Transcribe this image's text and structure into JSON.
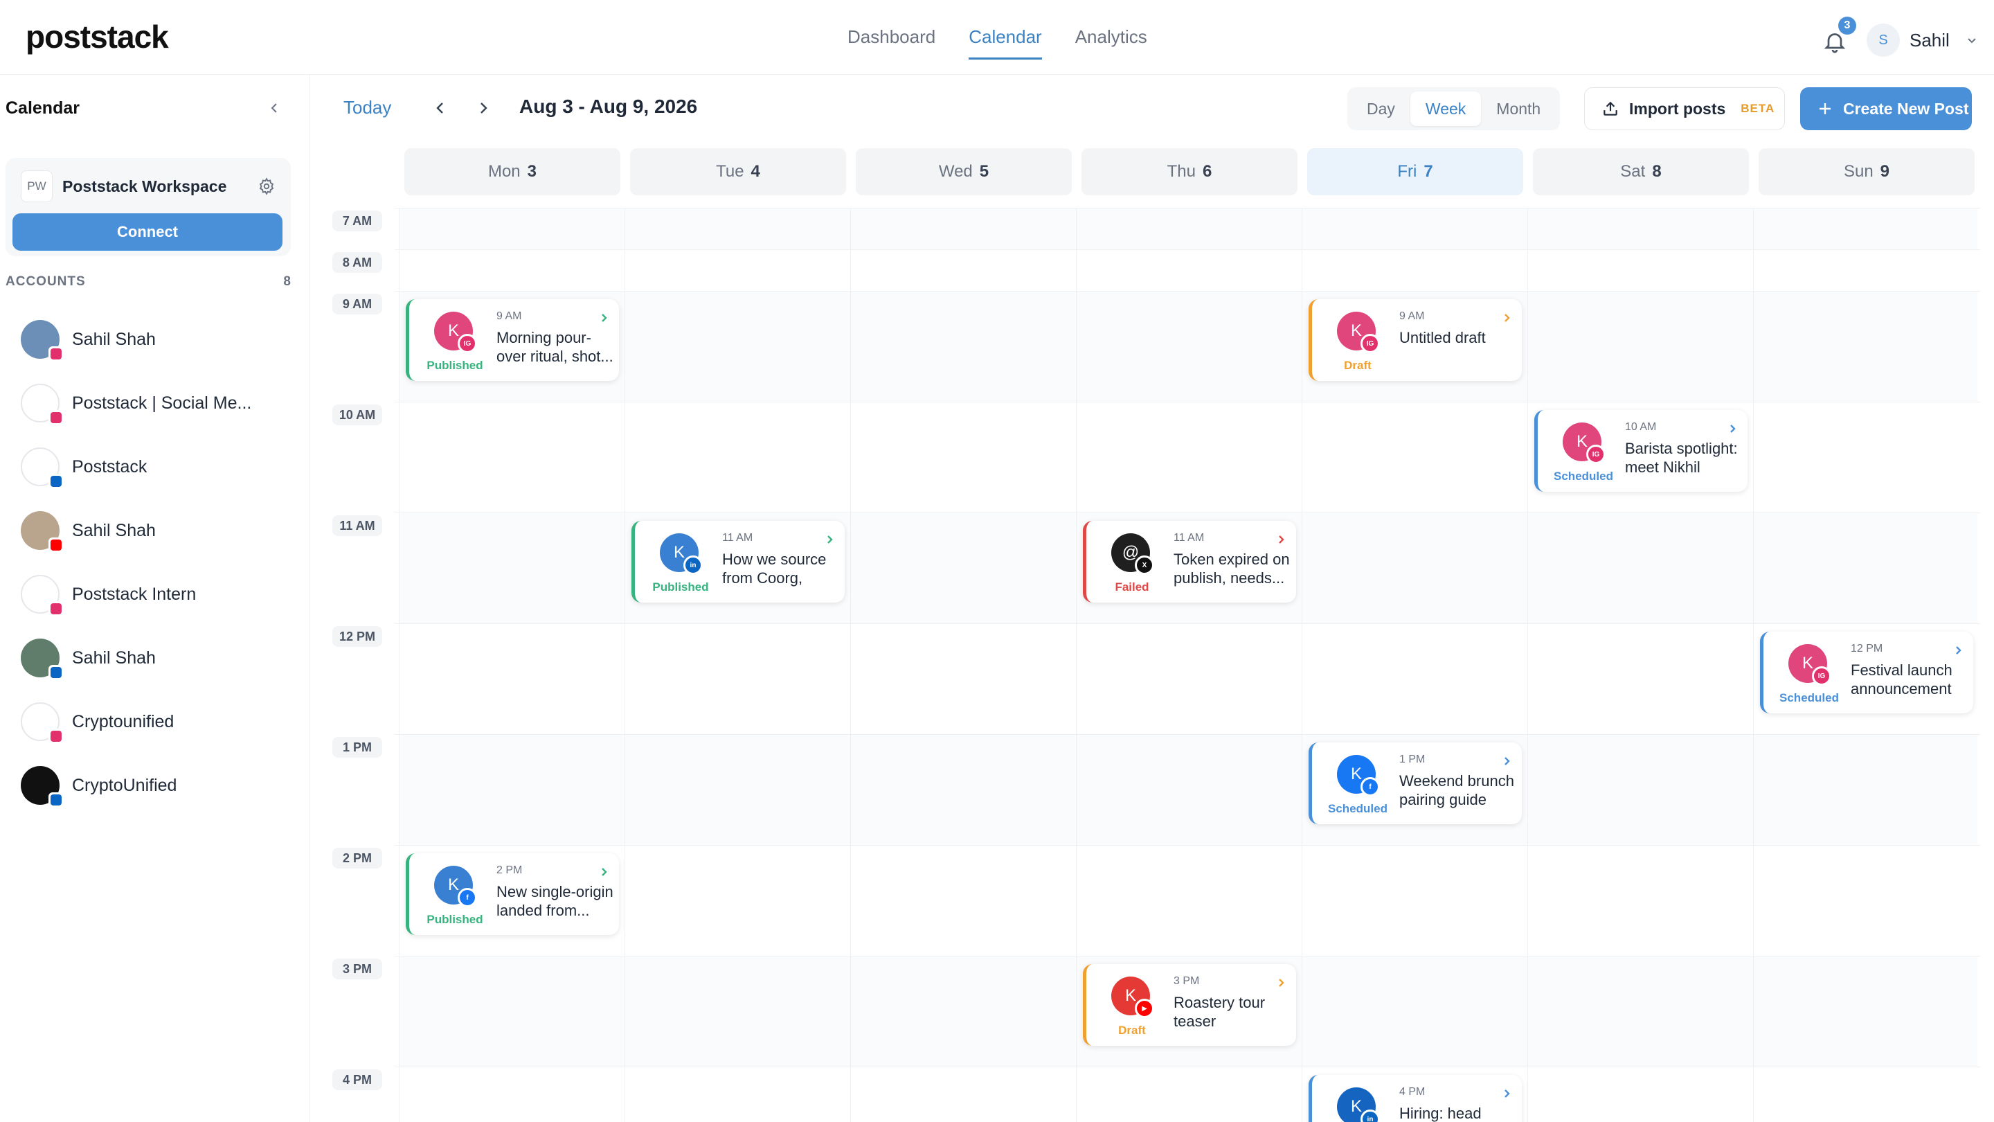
{
  "brand": {
    "logo": "poststack"
  },
  "nav": {
    "items": [
      {
        "label": "Dashboard"
      },
      {
        "label": "Calendar",
        "active": true
      },
      {
        "label": "Analytics"
      }
    ]
  },
  "notifications": {
    "count": "3"
  },
  "user": {
    "initial": "S",
    "name": "Sahil"
  },
  "sidebar": {
    "title": "Calendar",
    "workspace": {
      "initials": "PW",
      "name": "Poststack Workspace",
      "connect_label": "Connect"
    },
    "accounts_label": "ACCOUNTS",
    "accounts_count": "8",
    "accounts": [
      {
        "name": "Sahil Shah",
        "network": "instagram"
      },
      {
        "name": "Poststack | Social Me...",
        "network": "instagram"
      },
      {
        "name": "Poststack",
        "network": "linkedin"
      },
      {
        "name": "Sahil Shah",
        "network": "youtube"
      },
      {
        "name": "Poststack Intern",
        "network": "instagram"
      },
      {
        "name": "Sahil Shah",
        "network": "linkedin"
      },
      {
        "name": "Cryptounified",
        "network": "instagram"
      },
      {
        "name": "CryptoUnified",
        "network": "linkedin"
      }
    ]
  },
  "toolbar": {
    "today_label": "Today",
    "range_label": "Aug 3 - Aug 9, 2026",
    "views": [
      {
        "label": "Day"
      },
      {
        "label": "Week",
        "active": true
      },
      {
        "label": "Month"
      }
    ],
    "import_label": "Import posts",
    "beta_label": "BETA",
    "create_label": "Create New Post"
  },
  "calendar": {
    "days": [
      {
        "name": "Mon",
        "num": "3"
      },
      {
        "name": "Tue",
        "num": "4"
      },
      {
        "name": "Wed",
        "num": "5"
      },
      {
        "name": "Thu",
        "num": "6"
      },
      {
        "name": "Fri",
        "num": "7",
        "today": true
      },
      {
        "name": "Sat",
        "num": "8"
      },
      {
        "name": "Sun",
        "num": "9"
      }
    ],
    "hours": [
      "7 AM",
      "8 AM",
      "9 AM",
      "10 AM",
      "11 AM",
      "12 PM",
      "1 PM",
      "2 PM",
      "3 PM",
      "4 PM"
    ],
    "posts": [
      {
        "day": 0,
        "hour": 2,
        "time": "9 AM",
        "title": "Morning pour-over ritual, shot...",
        "status": "Published",
        "avatar": "K",
        "network": "instagram",
        "avatar_color": "#e0457b"
      },
      {
        "day": 4,
        "hour": 2,
        "time": "9 AM",
        "title": "Untitled draft",
        "status": "Draft",
        "avatar": "K",
        "network": "instagram",
        "avatar_color": "#e0457b"
      },
      {
        "day": 5,
        "hour": 3,
        "time": "10 AM",
        "title": "Barista spotlight: meet Nikhil",
        "status": "Scheduled",
        "avatar": "K",
        "network": "instagram",
        "avatar_color": "#e0457b"
      },
      {
        "day": 1,
        "hour": 4,
        "time": "11 AM",
        "title": "How we source from Coorg, and...",
        "status": "Published",
        "avatar": "K",
        "network": "linkedin",
        "avatar_color": "#3a80d2"
      },
      {
        "day": 3,
        "hour": 4,
        "time": "11 AM",
        "title": "Token expired on publish, needs...",
        "status": "Failed",
        "avatar": "@",
        "network": "x",
        "avatar_color": "#1f1f1f"
      },
      {
        "day": 6,
        "hour": 5,
        "time": "12 PM",
        "title": "Festival launch announcement",
        "status": "Scheduled",
        "avatar": "K",
        "network": "instagram",
        "avatar_color": "#e0457b"
      },
      {
        "day": 4,
        "hour": 6,
        "time": "1 PM",
        "title": "Weekend brunch pairing guide",
        "status": "Scheduled",
        "avatar": "K",
        "network": "facebook",
        "avatar_color": "#1877f2"
      },
      {
        "day": 0,
        "hour": 7,
        "time": "2 PM",
        "title": "New single-origin landed from...",
        "status": "Published",
        "avatar": "K",
        "network": "facebook",
        "avatar_color": "#3a80d2"
      },
      {
        "day": 3,
        "hour": 8,
        "time": "3 PM",
        "title": "Roastery tour teaser",
        "status": "Draft",
        "avatar": "K",
        "network": "youtube",
        "avatar_color": "#e53935"
      },
      {
        "day": 4,
        "hour": 9,
        "time": "4 PM",
        "title": "Hiring: head roaster for the...",
        "status": "Scheduled",
        "avatar": "K",
        "network": "linkedin",
        "avatar_color": "#1565c0"
      }
    ]
  },
  "colors": {
    "accent": "#4a90d9",
    "published": "#36b37e",
    "draft": "#f0a030",
    "failed": "#e04848",
    "scheduled": "#4a90d9",
    "instagram": "#e1306c",
    "linkedin": "#0a66c2",
    "facebook": "#1877f2",
    "youtube": "#ff0000",
    "x": "#111111"
  }
}
